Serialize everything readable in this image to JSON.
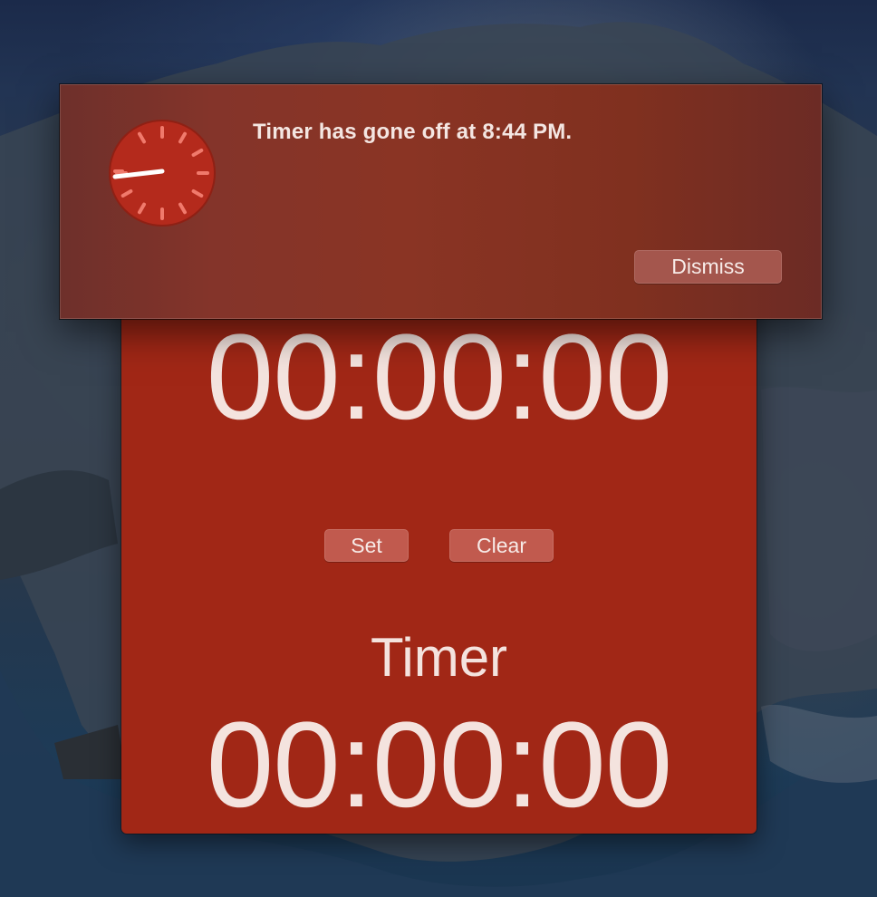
{
  "notification": {
    "message": "Timer has gone off at 8:44 PM.",
    "dismiss_label": "Dismiss",
    "icon": "clock-icon"
  },
  "timer_window": {
    "clock_display": "00:00:00",
    "set_label": "Set",
    "clear_label": "Clear",
    "timer_label": "Timer",
    "timer_display": "00:00:00"
  },
  "colors": {
    "window_background": "#a12716",
    "notification_background": "#84342a",
    "button_background": "#c15a4e",
    "text": "#f4e3de"
  }
}
